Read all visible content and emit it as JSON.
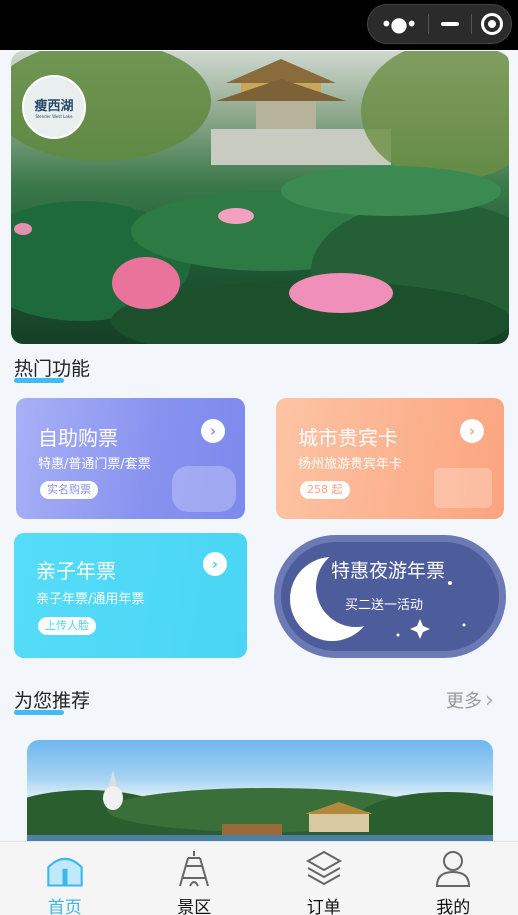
{
  "header": {
    "menu_icon": "more-dots-icon",
    "minimize_icon": "minimize-icon",
    "close_icon": "target-close-icon"
  },
  "banner": {
    "logo_text": "瘦西湖",
    "logo_sub": "Slender West Lake"
  },
  "hot_functions": {
    "title": "热门功能",
    "cards": [
      {
        "title": "自助购票",
        "subtitle": "特惠/普通门票/套票",
        "tag": "实名购票",
        "icon": "chevron-right-icon",
        "color": "#8792ef"
      },
      {
        "title": "城市贵宾卡",
        "subtitle": "扬州旅游贵宾年卡",
        "tag": "258 起",
        "icon": "chevron-right-icon",
        "color": "#fba47f"
      },
      {
        "title": "亲子年票",
        "subtitle": "亲子年票/通用年票",
        "tag": "上传人脸",
        "icon": "chevron-right-icon",
        "color": "#4ad5f6"
      },
      {
        "title": "特惠夜游年票",
        "subtitle": "买二送一活动",
        "icon": "crescent-moon-icon",
        "color": "#4d5c9b"
      }
    ]
  },
  "recommend": {
    "title": "为您推荐",
    "more_label": "更多"
  },
  "tabbar": {
    "items": [
      {
        "label": "首页",
        "icon": "home-icon",
        "active": true
      },
      {
        "label": "景区",
        "icon": "tower-icon",
        "active": false
      },
      {
        "label": "订单",
        "icon": "layers-icon",
        "active": false
      },
      {
        "label": "我的",
        "icon": "user-icon",
        "active": false
      }
    ]
  }
}
